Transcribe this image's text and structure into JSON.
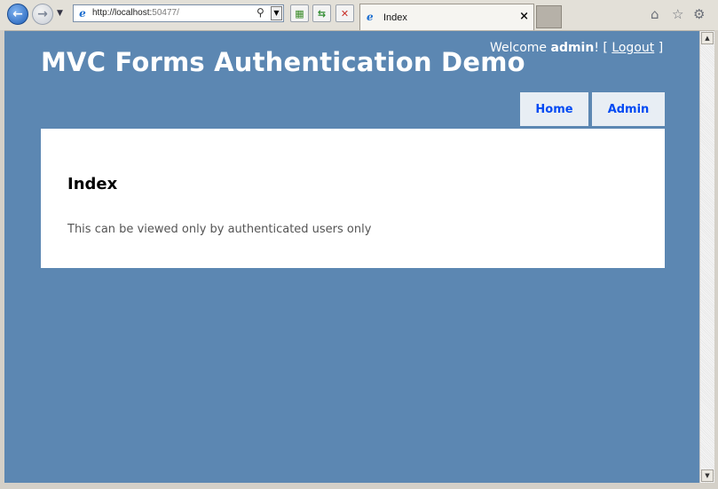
{
  "browser": {
    "url_host": "http://localhost:",
    "url_port": "50477/",
    "tab_title": "Index",
    "tab_close": "×",
    "icons": {
      "back": "back-arrow-icon",
      "forward": "forward-arrow-icon",
      "home": "home-icon",
      "favorites": "star-icon",
      "tools": "gear-icon"
    }
  },
  "site": {
    "title": "MVC Forms Authentication Demo",
    "welcome": "Welcome ",
    "username": "admin",
    "exclaim": "! [ ",
    "logout": "Logout",
    "close_bracket": " ]"
  },
  "menu": {
    "items": [
      {
        "label": "Home"
      },
      {
        "label": "Admin"
      }
    ]
  },
  "main": {
    "heading": "Index",
    "body_text": "This can be viewed only by authenticated users only"
  },
  "colors": {
    "page_background": "#5c87b2",
    "menu_tab_bg": "#e8eef4",
    "menu_link": "#034af3",
    "content_bg": "#ffffff"
  }
}
